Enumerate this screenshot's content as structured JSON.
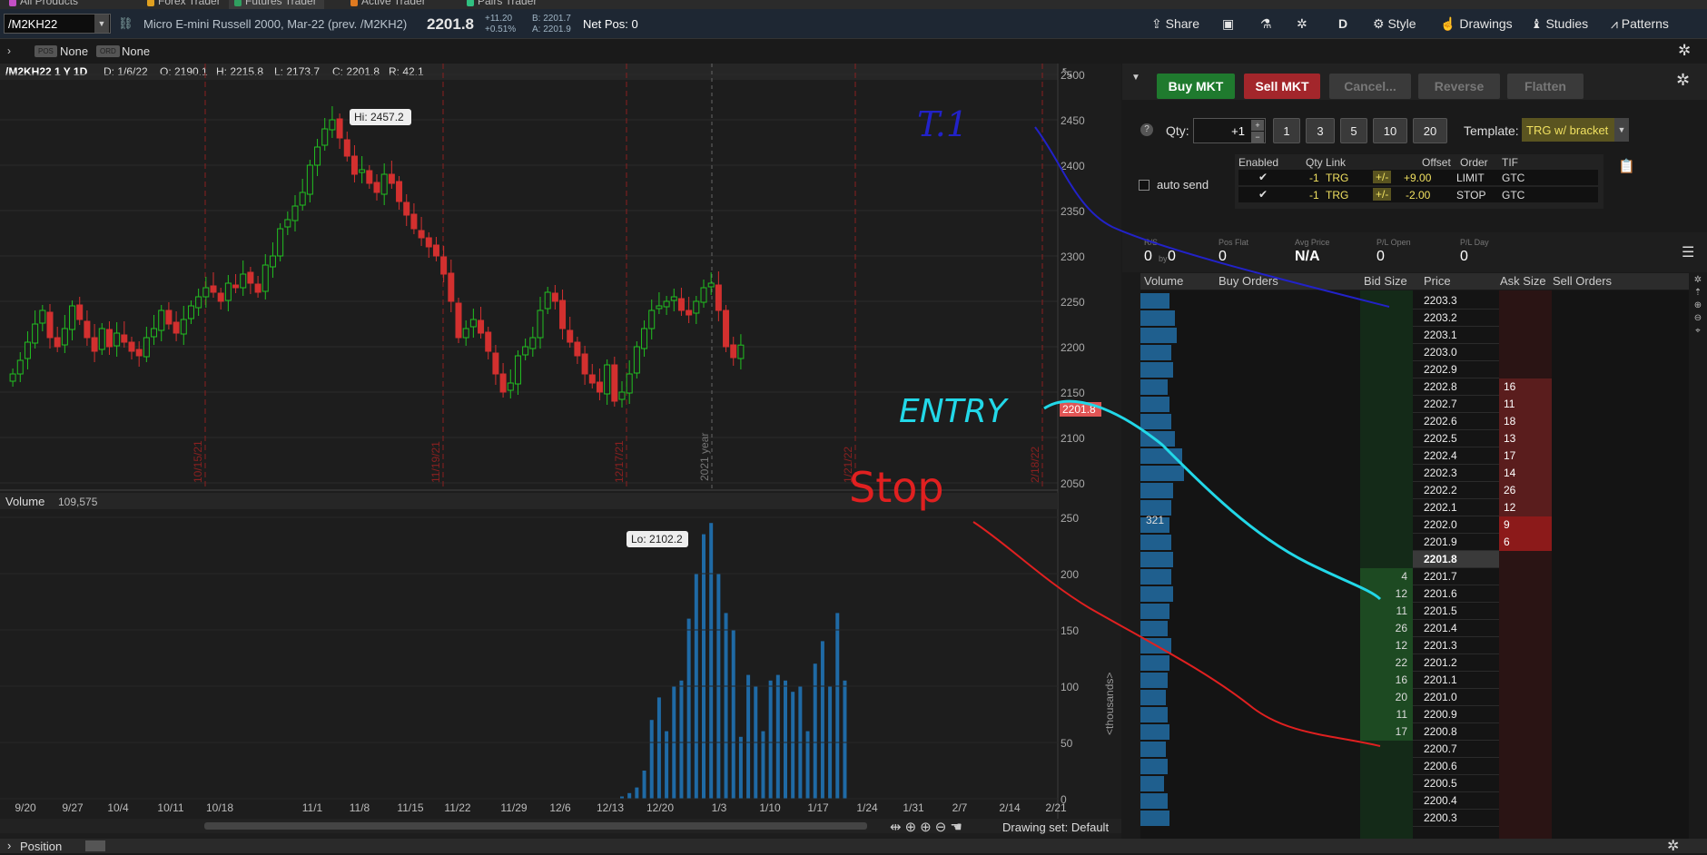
{
  "tabs": [
    {
      "label": "All Products",
      "color": "#c44fc4"
    },
    {
      "label": "Forex Trader",
      "color": "#e0a020"
    },
    {
      "label": "Futures Trader",
      "color": "#30a060"
    },
    {
      "label": "Active Trader",
      "color": "#e07a20"
    },
    {
      "label": "Pairs Trader",
      "color": "#30c080"
    }
  ],
  "symbol": {
    "ticker": "/M2KH22",
    "description": "Micro E-mini Russell 2000, Mar-22 (prev. /M2KH2)",
    "last": "2201.8",
    "change": "+11.20",
    "change_pct": "+0.51%",
    "bid": "B: 2201.7",
    "ask": "A: 2201.9",
    "net_pos": "Net Pos: 0"
  },
  "toolbar": {
    "share": "Share",
    "d": "D",
    "style": "Style",
    "drawings": "Drawings",
    "studies": "Studies",
    "patterns": "Patterns"
  },
  "row2": {
    "pos_badge": "POS",
    "pos_value": "None",
    "ord_badge": "ORD",
    "ord_value": "None"
  },
  "chart_header": {
    "title": "/M2KH22 1 Y 1D",
    "date": "D: 1/6/22",
    "open": "O: 2190.1",
    "high": "H: 2215.8",
    "low": "L: 2173.7",
    "close": "C: 2201.8",
    "range": "R: 42.1"
  },
  "chart_data": [
    {
      "type": "candlestick",
      "title": "/M2KH22 1 Y 1D",
      "ylim": [
        2050,
        2500
      ],
      "yticks": [
        2050,
        2100,
        2150,
        2200,
        2250,
        2300,
        2350,
        2400,
        2450,
        2500
      ],
      "x_tick_labels": [
        "9/20",
        "9/27",
        "10/4",
        "10/11",
        "10/18",
        "11/1",
        "11/8",
        "11/15",
        "11/22",
        "11/29",
        "12/6",
        "12/13",
        "12/20",
        "1/3",
        "1/10",
        "1/17",
        "1/24",
        "1/31",
        "2/7",
        "2/14",
        "2/21"
      ],
      "period_labels": [
        "10/15/21",
        "11/19/21",
        "12/17/21",
        "2021 year",
        "1/21/22",
        "2/18/22"
      ],
      "annotations": {
        "high": "Hi: 2457.2",
        "low": "Lo: 2102.2",
        "price_tag": "2201.8"
      },
      "close": [
        2170,
        2185,
        2205,
        2225,
        2240,
        2210,
        2200,
        2220,
        2245,
        2230,
        2210,
        2195,
        2220,
        2200,
        2215,
        2205,
        2195,
        2190,
        2210,
        2220,
        2240,
        2225,
        2215,
        2230,
        2245,
        2255,
        2265,
        2260,
        2250,
        2270,
        2265,
        2280,
        2270,
        2260,
        2290,
        2300,
        2330,
        2340,
        2355,
        2370,
        2400,
        2420,
        2440,
        2450,
        2430,
        2410,
        2390,
        2395,
        2380,
        2370,
        2390,
        2380,
        2360,
        2345,
        2330,
        2320,
        2310,
        2300,
        2280,
        2250,
        2210,
        2220,
        2230,
        2215,
        2195,
        2170,
        2150,
        2160,
        2190,
        2200,
        2210,
        2240,
        2260,
        2250,
        2220,
        2205,
        2190,
        2170,
        2160,
        2150,
        2180,
        2140,
        2150,
        2170,
        2200,
        2220,
        2240,
        2245,
        2250,
        2255,
        2240,
        2235,
        2250,
        2265,
        2270,
        2240,
        2200,
        2188,
        2201.8
      ]
    },
    {
      "type": "bar",
      "title": "Volume",
      "value_label": "109,575",
      "ylabel": "<thousands>",
      "ylim": [
        0,
        250
      ],
      "yticks": [
        0,
        50,
        100,
        150,
        200,
        250
      ],
      "values": [
        0,
        0,
        0,
        0,
        0,
        0,
        0,
        0,
        0,
        0,
        0,
        0,
        0,
        0,
        0,
        0,
        0,
        0,
        0,
        0,
        0,
        0,
        0,
        0,
        0,
        0,
        0,
        0,
        0,
        0,
        0,
        0,
        0,
        0,
        0,
        0,
        0,
        0,
        0,
        0,
        0,
        0,
        0,
        0,
        0,
        0,
        0,
        0,
        0,
        0,
        0,
        0,
        0,
        0,
        0,
        0,
        0,
        0,
        0,
        0,
        0,
        0,
        0,
        0,
        0,
        0,
        0,
        0,
        0,
        0,
        0,
        0,
        0,
        0,
        0,
        0,
        0,
        0,
        0,
        0,
        0,
        0,
        2,
        5,
        10,
        25,
        70,
        90,
        60,
        100,
        105,
        160,
        200,
        235,
        245,
        200,
        165,
        150,
        55,
        110,
        100,
        60,
        105,
        110,
        105,
        95,
        100,
        60,
        120,
        140,
        100,
        165,
        105
      ]
    }
  ],
  "footer_x": {
    "drawing_set": "Drawing set: Default"
  },
  "order_entry": {
    "buy": "Buy MKT",
    "sell": "Sell MKT",
    "cancel": "Cancel...",
    "reverse": "Reverse",
    "flatten": "Flatten",
    "qty_label": "Qty:",
    "qty_value": "+1",
    "qty_presets": [
      "1",
      "3",
      "5",
      "10",
      "20"
    ],
    "template_label": "Template:",
    "template_value": "TRG w/ bracket",
    "auto_send": "auto send",
    "bracket_headers": [
      "Enabled",
      "Qty",
      "Link",
      "Offset",
      "Order",
      "TIF"
    ],
    "bracket_rows": [
      {
        "qty": "-1",
        "link": "TRG",
        "sign": "+/-",
        "offset": "+9.00",
        "order": "LIMIT",
        "tif": "GTC"
      },
      {
        "qty": "-1",
        "link": "TRG",
        "sign": "+/-",
        "offset": "-2.00",
        "order": "STOP",
        "tif": "GTC"
      }
    ]
  },
  "summary": {
    "rs_label": "R/S",
    "rs_value": "0",
    "rs_by": "by",
    "rs_value2": "0",
    "posflat_label": "Pos Flat",
    "posflat_value": "0",
    "avgprice_label": "Avg Price",
    "avgprice_value": "N/A",
    "plopen_label": "P/L Open",
    "plopen_value": "0",
    "plday_label": "P/L Day",
    "plday_value": "0"
  },
  "ladder": {
    "headers": {
      "volume": "Volume",
      "buy_orders": "Buy Orders",
      "bid_size": "Bid Size",
      "price": "Price",
      "ask_size": "Ask Size",
      "sell_orders": "Sell Orders"
    },
    "volume_label": "321",
    "rows": [
      {
        "price": "2203.3",
        "bid": "",
        "ask": ""
      },
      {
        "price": "2203.2",
        "bid": "",
        "ask": ""
      },
      {
        "price": "2203.1",
        "bid": "",
        "ask": ""
      },
      {
        "price": "2203.0",
        "bid": "",
        "ask": ""
      },
      {
        "price": "2202.9",
        "bid": "",
        "ask": ""
      },
      {
        "price": "2202.8",
        "bid": "",
        "ask": "16"
      },
      {
        "price": "2202.7",
        "bid": "",
        "ask": "11"
      },
      {
        "price": "2202.6",
        "bid": "",
        "ask": "18"
      },
      {
        "price": "2202.5",
        "bid": "",
        "ask": "13"
      },
      {
        "price": "2202.4",
        "bid": "",
        "ask": "17"
      },
      {
        "price": "2202.3",
        "bid": "",
        "ask": "14"
      },
      {
        "price": "2202.2",
        "bid": "",
        "ask": "26"
      },
      {
        "price": "2202.1",
        "bid": "",
        "ask": "12"
      },
      {
        "price": "2202.0",
        "bid": "",
        "ask": "9"
      },
      {
        "price": "2201.9",
        "bid": "",
        "ask": "6"
      },
      {
        "price": "2201.8",
        "bid": "",
        "ask": ""
      },
      {
        "price": "2201.7",
        "bid": "4",
        "ask": ""
      },
      {
        "price": "2201.6",
        "bid": "12",
        "ask": ""
      },
      {
        "price": "2201.5",
        "bid": "11",
        "ask": ""
      },
      {
        "price": "2201.4",
        "bid": "26",
        "ask": ""
      },
      {
        "price": "2201.3",
        "bid": "12",
        "ask": ""
      },
      {
        "price": "2201.2",
        "bid": "22",
        "ask": ""
      },
      {
        "price": "2201.1",
        "bid": "16",
        "ask": ""
      },
      {
        "price": "2201.0",
        "bid": "20",
        "ask": ""
      },
      {
        "price": "2200.9",
        "bid": "11",
        "ask": ""
      },
      {
        "price": "2200.8",
        "bid": "17",
        "ask": ""
      },
      {
        "price": "2200.7",
        "bid": "",
        "ask": ""
      },
      {
        "price": "2200.6",
        "bid": "",
        "ask": ""
      },
      {
        "price": "2200.5",
        "bid": "",
        "ask": ""
      },
      {
        "price": "2200.4",
        "bid": "",
        "ask": ""
      },
      {
        "price": "2200.3",
        "bid": "",
        "ask": ""
      }
    ]
  },
  "handwriting": {
    "t1": "T.1",
    "entry": "ENTRY",
    "stop": "Stop"
  },
  "bottom": {
    "position": "Position"
  },
  "colors": {
    "up": "#21c021",
    "down": "#d2302f",
    "accent_buy": "#1f7a2e",
    "accent_sell": "#a3262b",
    "t1": "#2222c8",
    "entry": "#22d8e8",
    "stop": "#e02020"
  }
}
